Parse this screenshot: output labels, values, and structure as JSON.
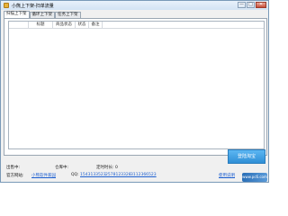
{
  "window": {
    "title": "小熊上下架-扫单流量",
    "controls": {
      "minimize": "—",
      "maximize": "□",
      "close": "✕"
    },
    "icon": "app-icon"
  },
  "tabs": [
    {
      "label": "扫描上下架",
      "active": true
    },
    {
      "label": "循环上下架",
      "active": false
    },
    {
      "label": "任务上下架",
      "active": false
    }
  ],
  "table": {
    "columns": [
      " ",
      "标题",
      "商品状态",
      "状态",
      "备注"
    ],
    "rows": []
  },
  "actions": {
    "primary_label": "登陆淘宝"
  },
  "status": {
    "stat1_label": "出售中:",
    "stat2_label": "仓库中:",
    "stat3_label": "定时时长: 0"
  },
  "footer": {
    "website_label": "官方网站:",
    "website_link": "小熊软件家园",
    "qq_label": "QQ:",
    "qq1": "1543133523",
    "qq2": "2578123328",
    "qq3": "3112366523",
    "help_link": "使用说明"
  },
  "watermark": {
    "text": "www.pc6.com"
  },
  "colors": {
    "primary": "#2f8fd6",
    "link": "#1d5fd0"
  }
}
